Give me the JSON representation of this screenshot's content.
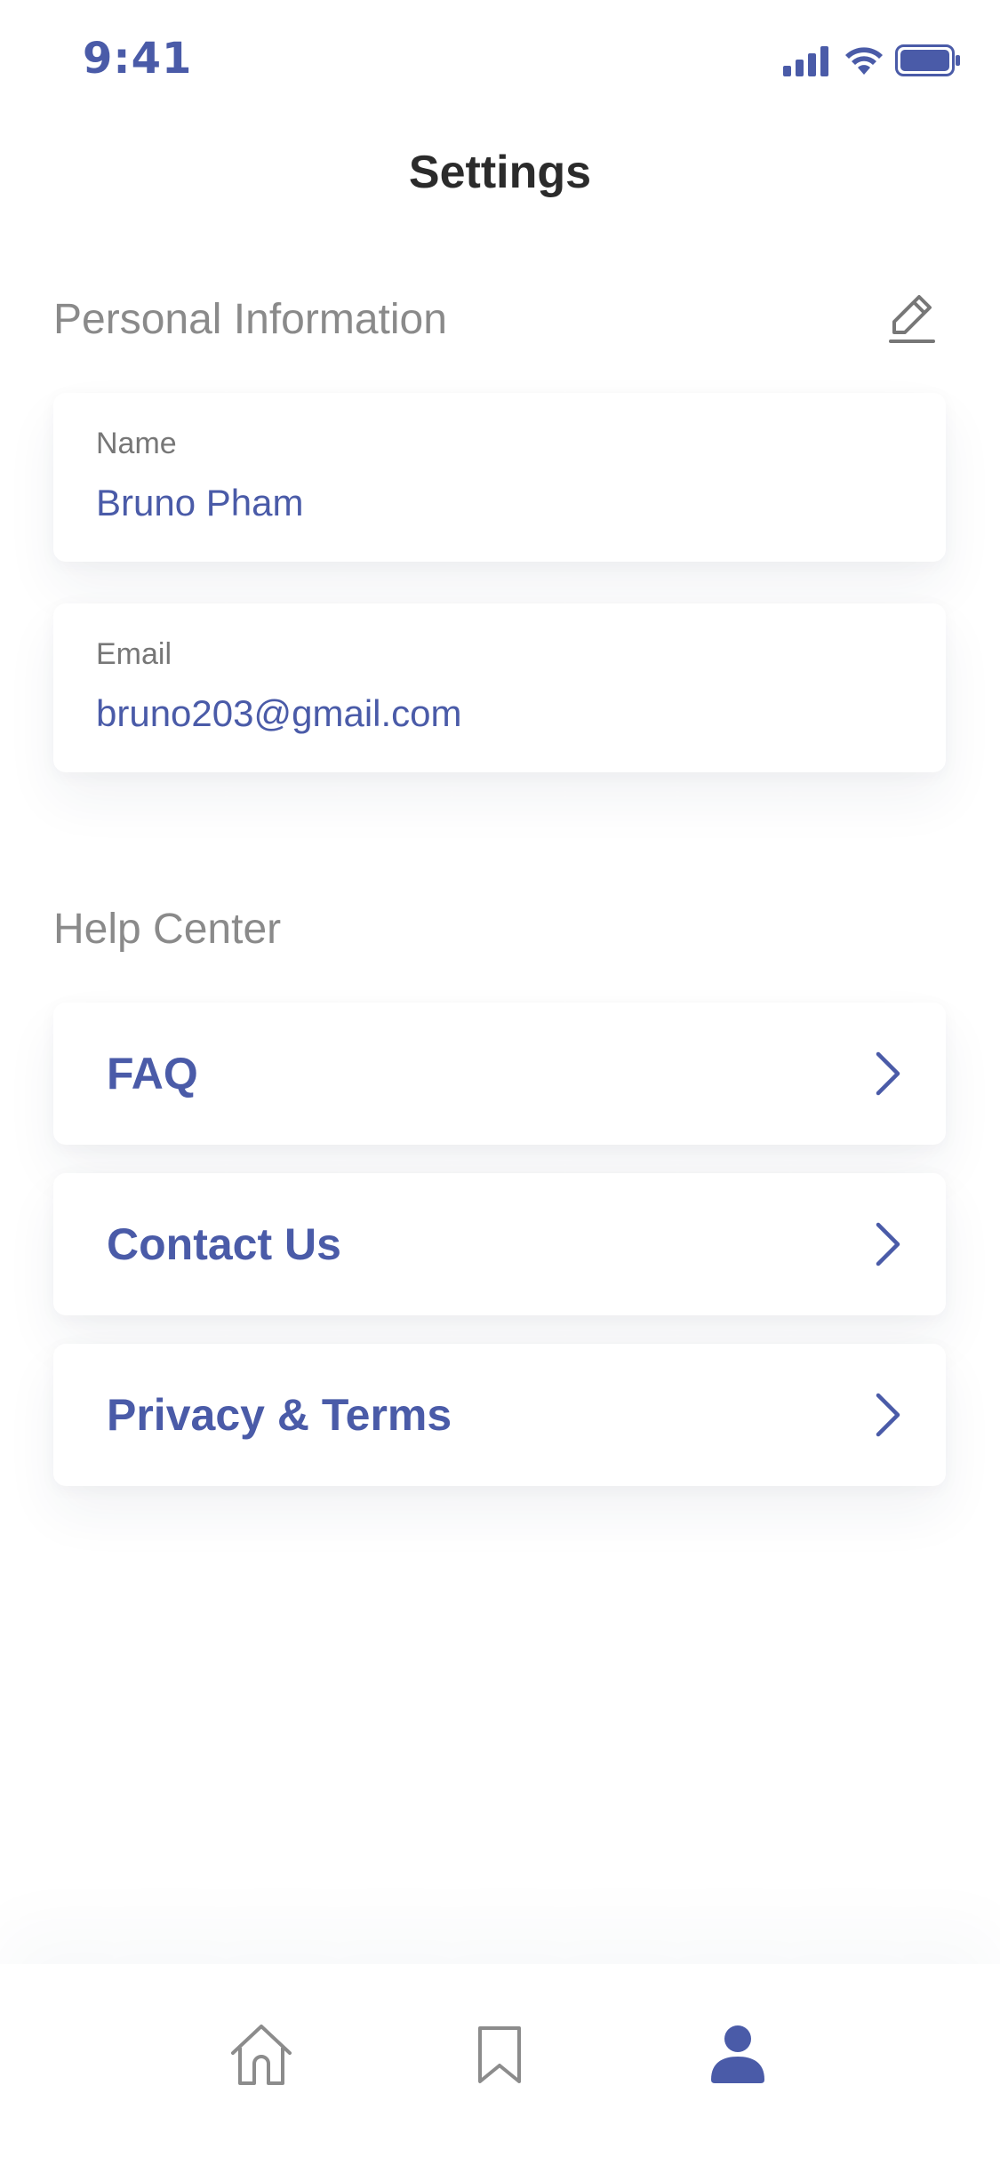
{
  "status_bar": {
    "time": "9:41",
    "icons": [
      "cellular-signal-icon",
      "wifi-icon",
      "battery-icon"
    ]
  },
  "header": {
    "title": "Settings"
  },
  "personal_info": {
    "section_title": "Personal Information",
    "edit_icon": "pencil-icon",
    "fields": [
      {
        "label": "Name",
        "value": "Bruno Pham"
      },
      {
        "label": "Email",
        "value": "bruno203@gmail.com"
      }
    ]
  },
  "help_center": {
    "section_title": "Help Center",
    "items": [
      {
        "label": "FAQ",
        "icon": "chevron-right-icon"
      },
      {
        "label": "Contact Us",
        "icon": "chevron-right-icon"
      },
      {
        "label": "Privacy & Terms",
        "icon": "chevron-right-icon"
      }
    ]
  },
  "tab_bar": {
    "tabs": [
      {
        "icon": "home-icon",
        "active": false
      },
      {
        "icon": "bookmark-icon",
        "active": false
      },
      {
        "icon": "profile-icon",
        "active": true
      }
    ]
  },
  "colors": {
    "accent": "#4a5ba8",
    "title": "#2b2b2b",
    "muted": "#8a8a8a",
    "inactive_icon": "#8c8c8c"
  }
}
